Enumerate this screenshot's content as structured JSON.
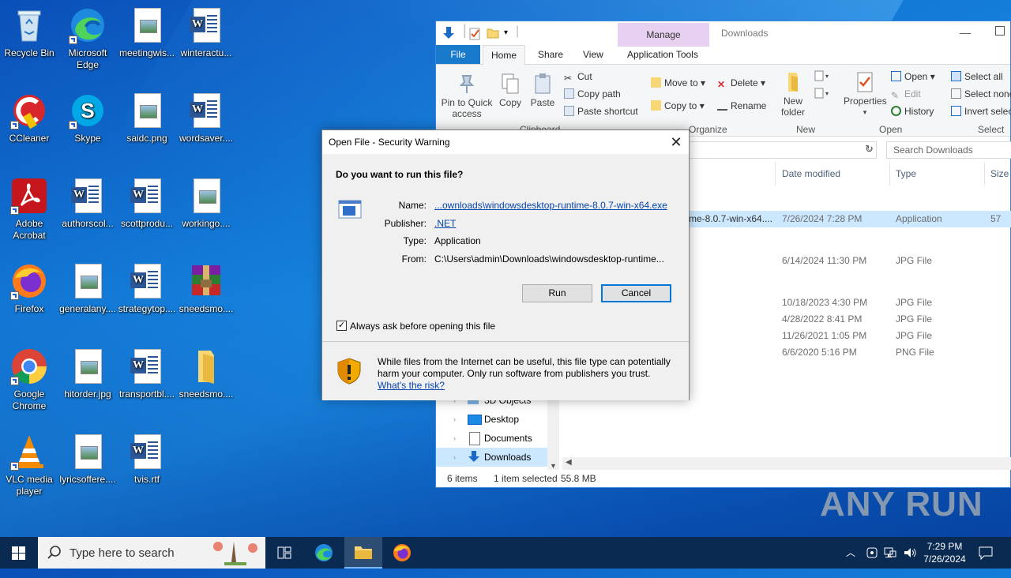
{
  "desktop": {
    "icons": [
      {
        "label": "Recycle Bin",
        "icon": "recycle-bin-icon"
      },
      {
        "label": "Microsoft Edge",
        "icon": "edge-icon"
      },
      {
        "label": "meetingwis...",
        "icon": "image-file-icon"
      },
      {
        "label": "winteractu...",
        "icon": "word-doc-icon"
      },
      {
        "label": "CCleaner",
        "icon": "ccleaner-icon"
      },
      {
        "label": "Skype",
        "icon": "skype-icon"
      },
      {
        "label": "saidc.png",
        "icon": "image-file-icon"
      },
      {
        "label": "wordsaver....",
        "icon": "word-doc-icon"
      },
      {
        "label": "Adobe Acrobat",
        "icon": "acrobat-icon"
      },
      {
        "label": "authorscol...",
        "icon": "word-doc-icon"
      },
      {
        "label": "scottprodu...",
        "icon": "word-doc-icon"
      },
      {
        "label": "workingo....",
        "icon": "image-file-icon"
      },
      {
        "label": "Firefox",
        "icon": "firefox-icon"
      },
      {
        "label": "generalany....",
        "icon": "image-file-icon"
      },
      {
        "label": "strategytop....",
        "icon": "word-doc-icon"
      },
      {
        "label": "sneedsmo....",
        "icon": "winrar-icon"
      },
      {
        "label": "Google Chrome",
        "icon": "chrome-icon"
      },
      {
        "label": "hitorder.jpg",
        "icon": "image-file-icon"
      },
      {
        "label": "transportbl....",
        "icon": "word-doc-icon"
      },
      {
        "label": "sneedsmo....",
        "icon": "folder-icon"
      },
      {
        "label": "VLC media player",
        "icon": "vlc-icon"
      },
      {
        "label": "lyricsoffere....",
        "icon": "image-file-icon"
      },
      {
        "label": "tvis.rtf",
        "icon": "word-doc-icon"
      }
    ]
  },
  "explorer": {
    "title": "Downloads",
    "context_tab": "Manage",
    "tabs": [
      "File",
      "Home",
      "Share",
      "View",
      "Application Tools"
    ],
    "ribbon": {
      "pin": "Pin to Quick access",
      "copy": "Copy",
      "paste": "Paste",
      "cut": "Cut",
      "copy_path": "Copy path",
      "paste_shortcut": "Paste shortcut",
      "clipboard": "Clipboard",
      "move_to": "Move to",
      "copy_to": "Copy to",
      "delete": "Delete",
      "rename": "Rename",
      "organize": "Organize",
      "new_folder": "New folder",
      "new": "New",
      "properties": "Properties",
      "open": "Open",
      "edit": "Edit",
      "history": "History",
      "open_group": "Open",
      "select_all": "Select all",
      "select_none": "Select none",
      "invert_selection": "Invert selec",
      "select_group": "Select"
    },
    "search_placeholder": "Search Downloads",
    "columns": {
      "date": "Date modified",
      "type": "Type",
      "size": "Size"
    },
    "rows": [
      {
        "name": "me-8.0.7-win-x64....",
        "date": "7/26/2024 7:28 PM",
        "type": "Application",
        "size": "57",
        "selected": true
      },
      {
        "name": "",
        "date": "6/14/2024 11:30 PM",
        "type": "JPG File",
        "size": ""
      },
      {
        "name": "",
        "date": "10/18/2023 4:30 PM",
        "type": "JPG File",
        "size": ""
      },
      {
        "name": "",
        "date": "4/28/2022 8:41 PM",
        "type": "JPG File",
        "size": ""
      },
      {
        "name": "",
        "date": "11/26/2021 1:05 PM",
        "type": "JPG File",
        "size": ""
      },
      {
        "name": "",
        "date": "6/6/2020 5:16 PM",
        "type": "PNG File",
        "size": ""
      }
    ],
    "nav": [
      "3D Objects",
      "Desktop",
      "Documents",
      "Downloads"
    ],
    "status": {
      "items": "6 items",
      "selected": "1 item selected",
      "size": "55.8 MB"
    }
  },
  "dialog": {
    "title": "Open File - Security Warning",
    "question": "Do you want to run this file?",
    "labels": {
      "name": "Name:",
      "publisher": "Publisher:",
      "type": "Type:",
      "from": "From:"
    },
    "name": "...ownloads\\windowsdesktop-runtime-8.0.7-win-x64.exe",
    "publisher": ".NET",
    "type": "Application",
    "from": "C:\\Users\\admin\\Downloads\\windowsdesktop-runtime...",
    "run": "Run",
    "cancel": "Cancel",
    "always_ask": "Always ask before opening this file",
    "always_ask_checked": true,
    "warning": "While files from the Internet can be useful, this file type can potentially harm your computer. Only run software from publishers you trust.",
    "risk_link": "What's the risk?"
  },
  "taskbar": {
    "search_placeholder": "Type here to search",
    "time": "7:29 PM",
    "date": "7/26/2024"
  },
  "watermark": "ANY RUN"
}
